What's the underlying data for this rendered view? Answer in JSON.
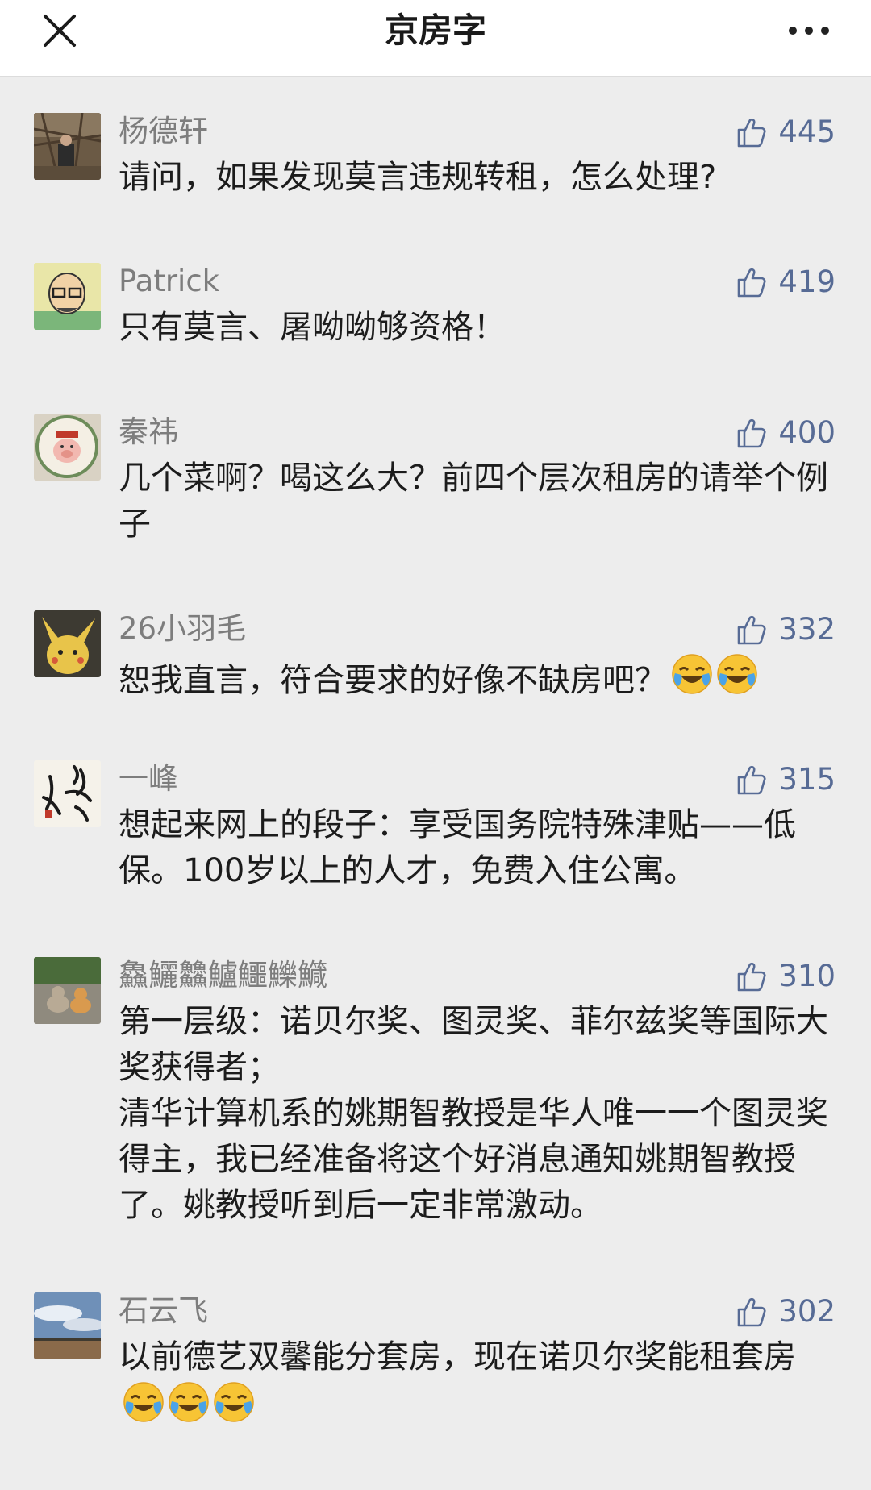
{
  "header": {
    "title": "京房字",
    "close_icon": "close-icon",
    "more_icon": "more-horizontal-icon"
  },
  "colors": {
    "background": "#ededed",
    "like_blue": "#576b95",
    "name_gray": "#7d7d7d"
  },
  "comments": [
    {
      "name": "杨德轩",
      "likes": "445",
      "text": "请问，如果发现莫言违规转租，怎么处理?",
      "avatar_icon": "avatar-woodpile-photo"
    },
    {
      "name": "Patrick",
      "likes": "419",
      "text": "只有莫言、屠呦呦够资格！",
      "avatar_icon": "avatar-cartoon-man"
    },
    {
      "name": "秦祎",
      "likes": "400",
      "text": "几个菜啊？喝这么大？前四个层次租房的请举个例子",
      "avatar_icon": "avatar-pig-plate"
    },
    {
      "name": "26小羽毛",
      "likes": "332",
      "text": "恕我直言，符合要求的好像不缺房吧？",
      "avatar_icon": "avatar-pikachu",
      "emojis": [
        "laugh-cry-emoji",
        "laugh-cry-emoji"
      ]
    },
    {
      "name": "一峰",
      "likes": "315",
      "text": "想起来网上的段子：享受国务院特殊津贴——低保。100岁以上的人才，免费入住公寓。",
      "avatar_icon": "avatar-calligraphy"
    },
    {
      "name": "鱻鱺䲜鱸鱷鱳鱵",
      "likes": "310",
      "text": "第一层级：诺贝尔奖、图灵奖、菲尔兹奖等国际大奖获得者；",
      "text2": "清华计算机系的姚期智教授是华人唯一一个图灵奖得主，我已经准备将这个好消息通知姚期智教授了。姚教授听到后一定非常激动。",
      "avatar_icon": "avatar-cats"
    },
    {
      "name": "石云飞",
      "likes": "302",
      "text": "以前德艺双馨能分套房，现在诺贝尔奖能租套房",
      "avatar_icon": "avatar-sky-landscape",
      "emojis": [
        "tears-of-joy-emoji",
        "tears-of-joy-emoji",
        "tears-of-joy-emoji"
      ]
    }
  ]
}
